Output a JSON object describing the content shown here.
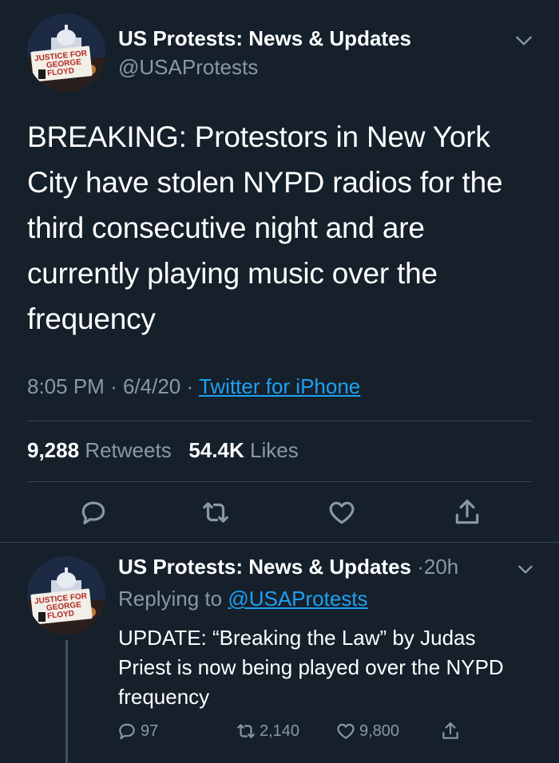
{
  "main_tweet": {
    "author_name": "US Protests: News & Updates",
    "author_handle": "@USAProtests",
    "avatar_sign_text": "JUSTICE FOR GEORGE FLOYD",
    "text": "BREAKING: Protestors in New York City have stolen NYPD radios for the third consecutive night and are currently playing music over the frequency",
    "time": "8:05 PM",
    "date": "6/4/20",
    "separator": "·",
    "source": "Twitter for iPhone",
    "retweets_count": "9,288",
    "retweets_label": "Retweets",
    "likes_count": "54.4K",
    "likes_label": "Likes",
    "icons": [
      "reply-icon",
      "retweet-icon",
      "like-icon",
      "share-icon",
      "chevron-down-icon"
    ]
  },
  "reply_tweet": {
    "author_name": "US Protests: News & Updates",
    "separator": "·",
    "age": "20h",
    "replying_label": "Replying to",
    "replying_handle": "@USAProtests",
    "text": "UPDATE: “Breaking the Law” by Judas Priest is now being played over the NYPD frequency",
    "reply_count": "97",
    "retweet_count": "2,140",
    "like_count": "9,800"
  },
  "colors": {
    "background": "#15202b",
    "text": "#ffffff",
    "muted": "#8899a6",
    "link": "#1da1f2",
    "divider": "#38444d"
  }
}
